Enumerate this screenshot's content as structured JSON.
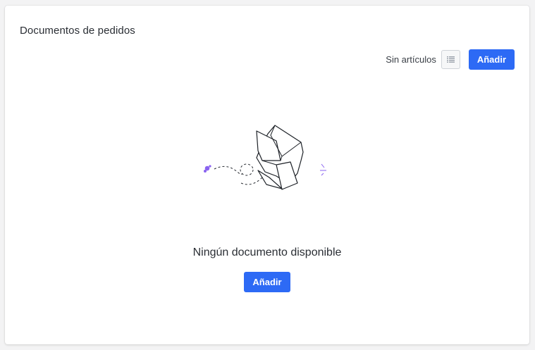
{
  "card": {
    "title": "Documentos de pedidos"
  },
  "toolbar": {
    "status_label": "Sin artículos",
    "list_icon": "list-icon",
    "add_label": "Añadir"
  },
  "empty_state": {
    "illustration_icon": "open-box-icon",
    "message": "Ningún documento disponible",
    "add_label": "Añadir"
  },
  "colors": {
    "primary": "#2d6af5",
    "accent_purple": "#8a63f0"
  }
}
